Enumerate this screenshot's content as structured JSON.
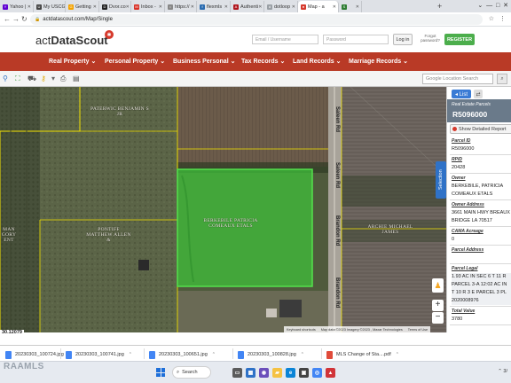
{
  "browser": {
    "tabs": [
      {
        "label": "Yahoo |",
        "icon_color": "#6001d2",
        "icon_glyph": "Y"
      },
      {
        "label": "My USCG",
        "icon_color": "#444444",
        "icon_glyph": "U"
      },
      {
        "label": "Getting",
        "icon_color": "#f4a300",
        "icon_glyph": "G"
      },
      {
        "label": "Dvor.co",
        "icon_color": "#222222",
        "icon_glyph": "D"
      },
      {
        "label": "Inbox -",
        "icon_color": "#d93025",
        "icon_glyph": "M"
      },
      {
        "label": "https://",
        "icon_color": "#888888",
        "icon_glyph": "•"
      },
      {
        "label": "flexmls",
        "icon_color": "#2b6cb0",
        "icon_glyph": "f"
      },
      {
        "label": "Authenti",
        "icon_color": "#b0141b",
        "icon_glyph": "A"
      },
      {
        "label": "dotloop",
        "icon_color": "#9aa0a6",
        "icon_glyph": "d"
      },
      {
        "label": "Map - a",
        "icon_color": "#d63a2d",
        "icon_glyph": "●"
      },
      {
        "label": "",
        "icon_color": "#2e7d32",
        "icon_glyph": "S"
      }
    ],
    "address": "actdatascout.com/Map/Single"
  },
  "site": {
    "logo_prefix": "act",
    "logo_main": "DataScout",
    "email_placeholder": "Email / Username",
    "password_placeholder": "Password",
    "login_label": "Log in",
    "forgot_label": "Forgot password?",
    "register_label": "REGISTER"
  },
  "nav": {
    "items": [
      "Real Property ⌄",
      "Personal Property ⌄",
      "Business Personal ⌄",
      "Tax Records ⌄",
      "Land Records ⌄",
      "Marriage Records ⌄"
    ]
  },
  "map_toolbar": {
    "search_placeholder": "Google Location Search"
  },
  "map": {
    "labels": [
      {
        "text": "PATERWIC BENJAMIN S JR"
      },
      {
        "text": "BERKEBILE PATRICIA COMEAUX ETALS"
      },
      {
        "text": "PONTIFF MATTHEW ALLEN &"
      },
      {
        "text": "ARCHIE MICHAEL JAMES"
      },
      {
        "text": "MAN GORY ENT"
      }
    ],
    "roads": [
      "Saleen Rd",
      "Saleen Rd",
      "Brandon Rd",
      "Brandon Rd"
    ],
    "attribution": [
      "Keyboard shortcuts",
      "Map data ©2023 Imagery ©2023 , Maxar Technologies",
      "Terms of Use"
    ],
    "scale_readout": "30.12079",
    "selection_tab": "Selection",
    "parcel_color": "#3ec43a"
  },
  "panel": {
    "list_label": "◂ List",
    "header_sub": "Real Estate Parcels",
    "parcel_id": "R5096000",
    "show_detail_label": "Show Detailed Report",
    "fields": [
      {
        "label": "Parcel ID",
        "lines": [
          "R5096000"
        ]
      },
      {
        "label": "RPID",
        "lines": [
          "20428"
        ]
      },
      {
        "label": "Owner",
        "lines": [
          "BERKEBILE, PATRICIA",
          "COMEAUX ETALS"
        ]
      },
      {
        "label": "Owner Address",
        "lines": [
          "3661 MAIN HWY BREAUX",
          "BRIDGE LA 70517"
        ]
      },
      {
        "label": "CAMA Acreage",
        "lines": [
          "0"
        ]
      },
      {
        "label": "Parcel Address",
        "lines": [
          ""
        ]
      },
      {
        "label": "Parcel Legal",
        "lines": [
          "1.93 AC IN SEC 6 T 11 R",
          "PARCEL 3-A 12:02 AC IN",
          "T 10 R 3 E PARCEL 3 PL",
          "2020008976"
        ]
      },
      {
        "label": "Total Value",
        "lines": [
          "3780"
        ]
      }
    ]
  },
  "downloads": [
    {
      "name": "20230303_100724.jpg",
      "type": "jpg"
    },
    {
      "name": "20230303_100741.jpg",
      "type": "jpg"
    },
    {
      "name": "20230303_100651.jpg",
      "type": "jpg"
    },
    {
      "name": "20230303_100828.jpg",
      "type": "jpg"
    },
    {
      "name": "MLS Change of Sta....pdf",
      "type": "pdf"
    }
  ],
  "taskbar": {
    "watermark": "RAAMLS",
    "search_label": "Search",
    "tray_text": "3/"
  }
}
